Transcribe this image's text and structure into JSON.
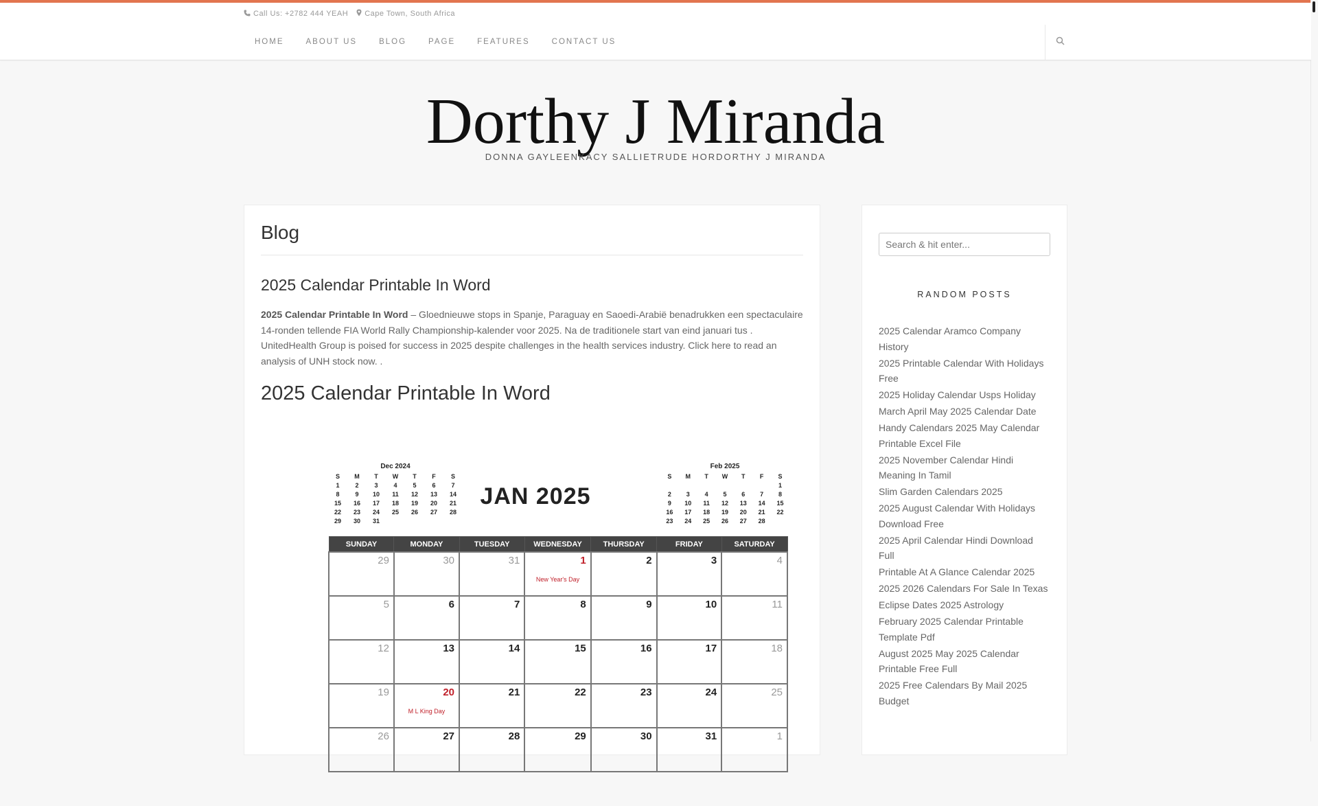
{
  "topbar": {
    "phone": "Call Us: +2782 444 YEAH",
    "location": "Cape Town, South Africa"
  },
  "nav": {
    "items": [
      "HOME",
      "ABOUT US",
      "BLOG",
      "PAGE",
      "FEATURES",
      "CONTACT US"
    ]
  },
  "site": {
    "title": "Dorthy J Miranda",
    "description": "DONNA GAYLEENKACY SALLIETRUDE HORDORTHY J MIRANDA"
  },
  "main": {
    "heading": "Blog",
    "post_title": "2025 Calendar Printable In Word",
    "excerpt_bold": "2025 Calendar Printable In Word",
    "excerpt_text": " – Gloednieuwe stops in Spanje, Paraguay en Saoedi-Arabië benadrukken een spectaculaire 14-ronden tellende FIA World Rally Championship-kalender voor 2025. Na de traditionele start van eind januari tus . UnitedHealth Group is poised for success in 2025 despite challenges in the health services industry. Click here to read an analysis of UNH stock now. .",
    "post_h2": "2025 Calendar Printable In Word"
  },
  "calendar": {
    "title": "JAN 2025",
    "prev_title": "Dec 2024",
    "next_title": "Feb 2025",
    "mini_days": [
      "S",
      "M",
      "T",
      "W",
      "T",
      "F",
      "S"
    ],
    "days": [
      "SUNDAY",
      "MONDAY",
      "TUESDAY",
      "WEDNESDAY",
      "THURSDAY",
      "FRIDAY",
      "SATURDAY"
    ],
    "holiday_1": "New Year's Day",
    "holiday_20": "M L King Day"
  },
  "sidebar": {
    "search_placeholder": "Search & hit enter...",
    "widget_title": "RANDOM POSTS",
    "posts": [
      "2025 Calendar Aramco Company History",
      "2025 Printable Calendar With Holidays Free",
      "2025 Holiday Calendar Usps Holiday",
      "March April May 2025 Calendar Date",
      "Handy Calendars 2025 May Calendar Printable Excel File",
      "2025 November Calendar Hindi Meaning In Tamil",
      "Slim Garden Calendars 2025",
      "2025 August Calendar With Holidays Download Free",
      "2025 April Calendar Hindi Download Full",
      "Printable At A Glance Calendar 2025",
      "2025 2026 Calendars For Sale In Texas",
      "Eclipse Dates 2025 Astrology",
      "February 2025 Calendar Printable Template Pdf",
      "August 2025 May 2025 Calendar Printable Free Full",
      "2025 Free Calendars By Mail 2025 Budget"
    ]
  },
  "colors": {
    "accent": "#e2754f",
    "holiday": "#c0202a"
  }
}
